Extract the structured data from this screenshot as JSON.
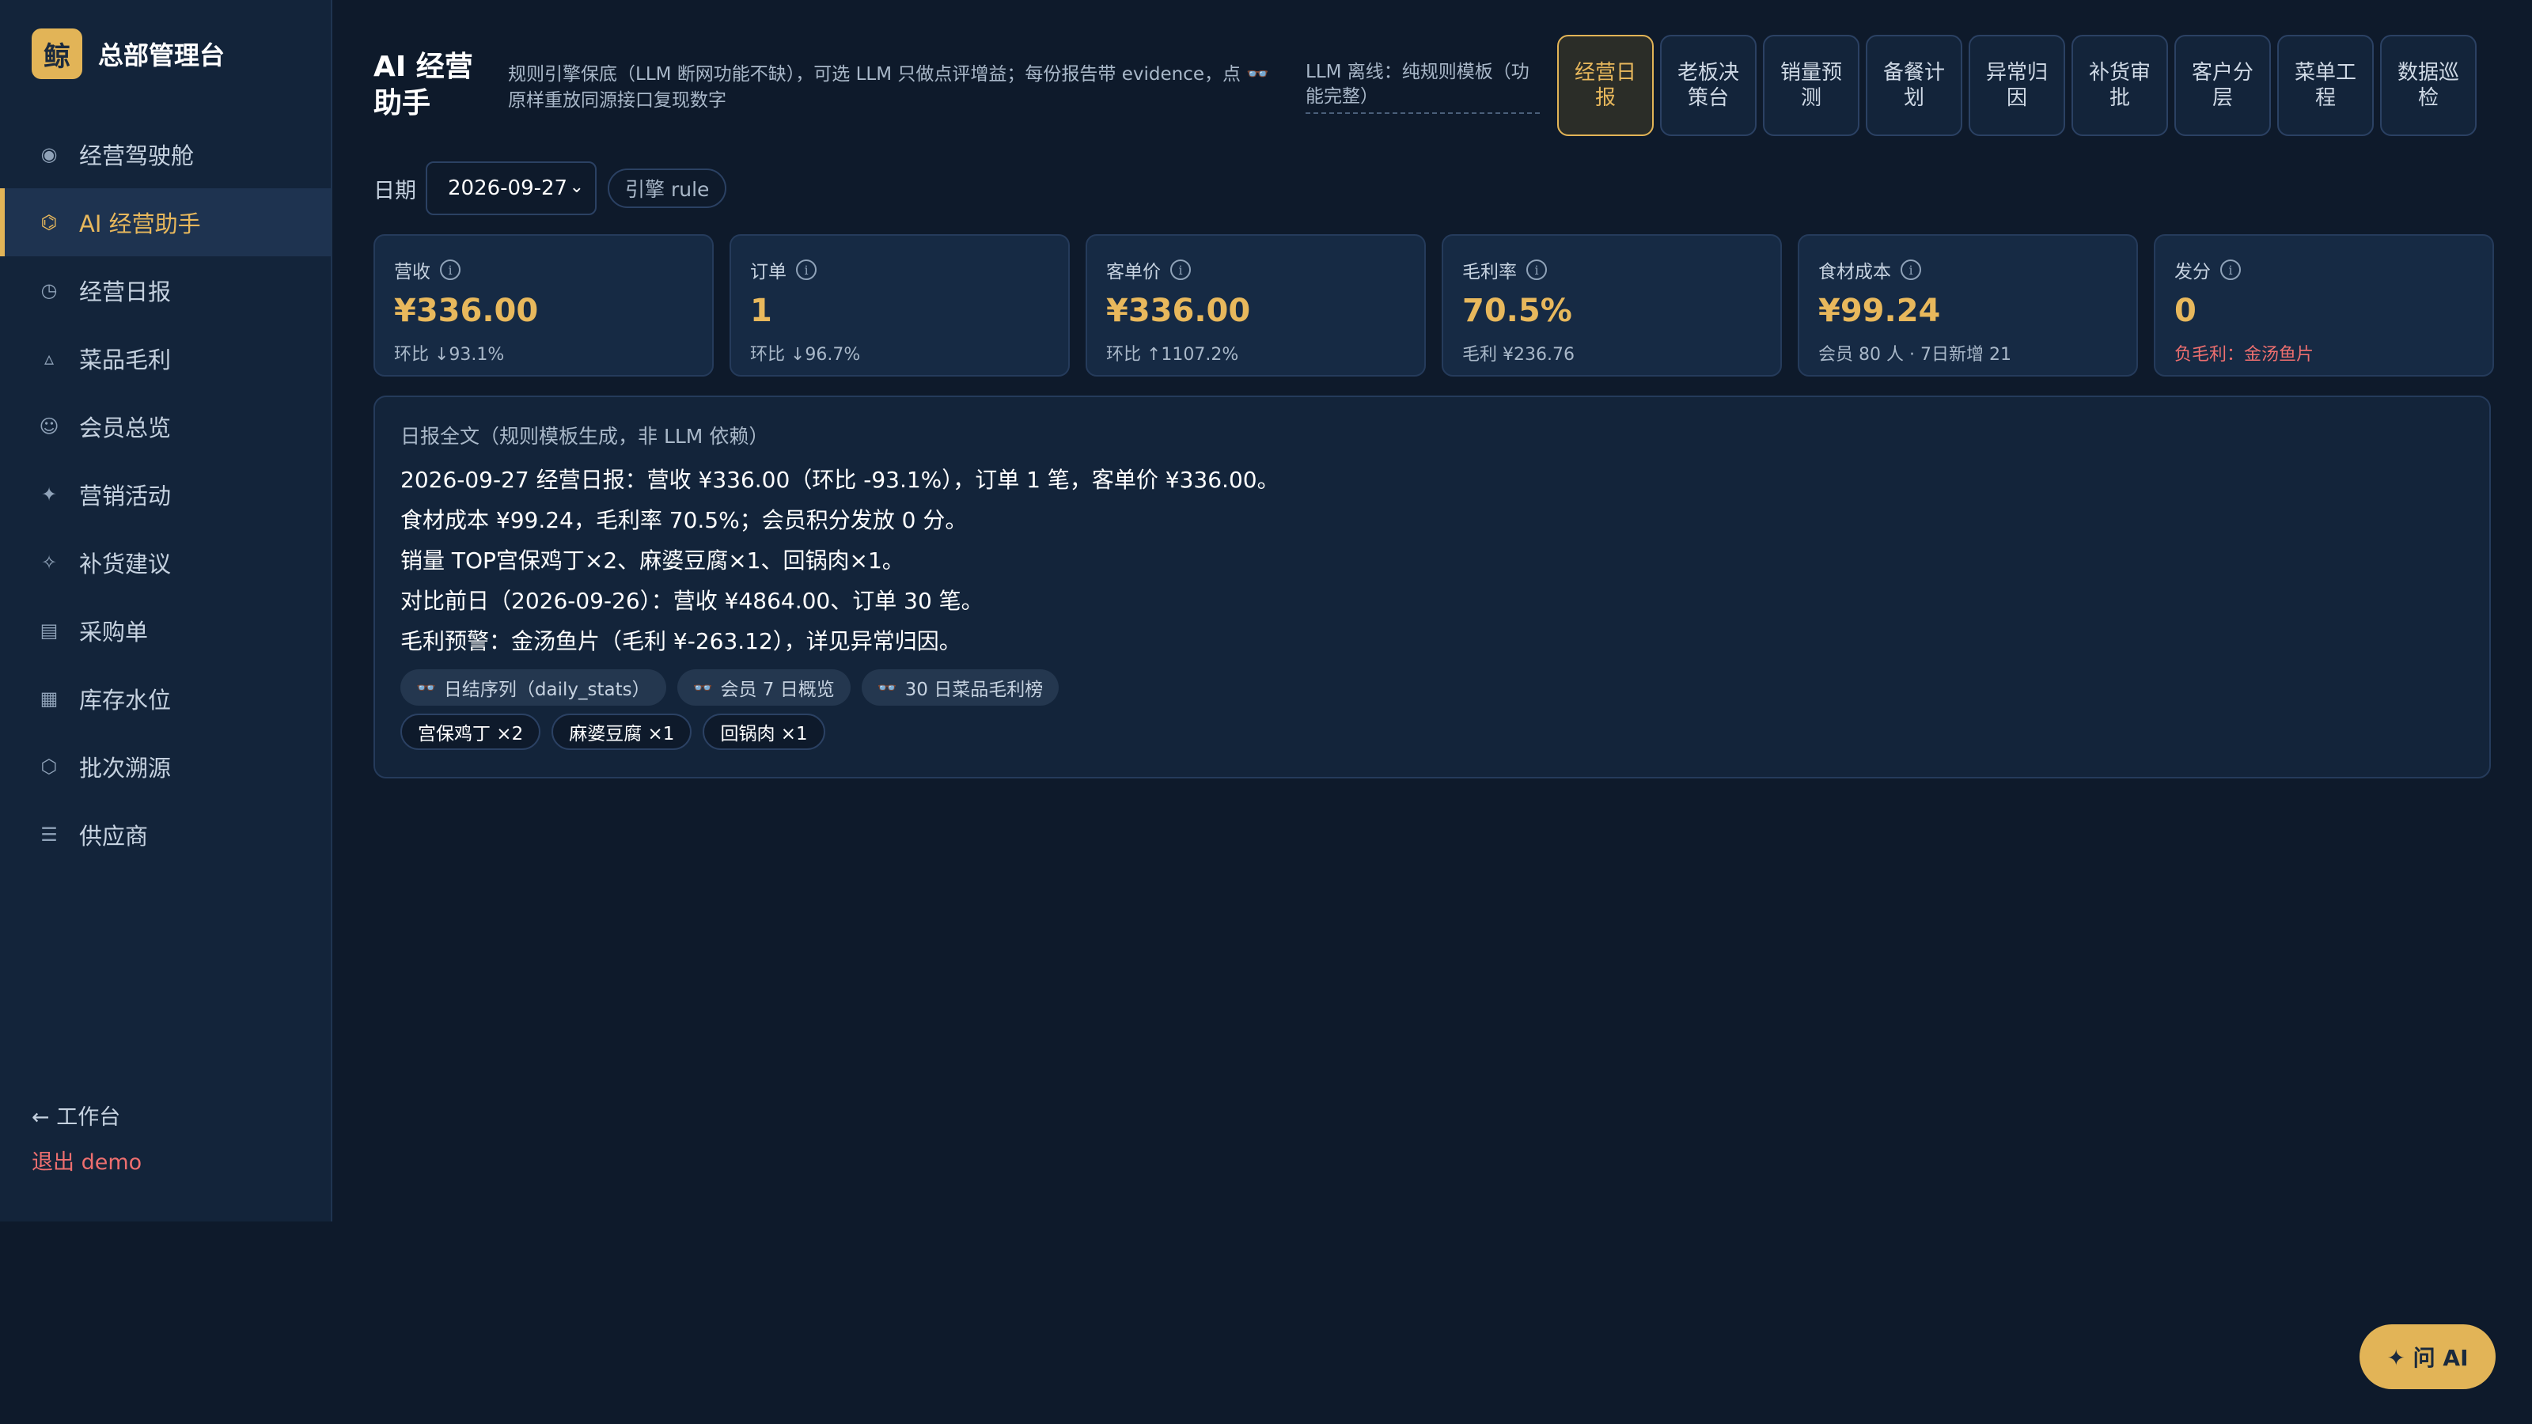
{
  "brand": {
    "logo_char": "鲸",
    "name": "总部管理台"
  },
  "sidebar": {
    "items": [
      {
        "icon": "◉",
        "label": "经营驾驶舱"
      },
      {
        "icon": "⌬",
        "label": "AI 经营助手"
      },
      {
        "icon": "◷",
        "label": "经营日报"
      },
      {
        "icon": "▵",
        "label": "菜品毛利"
      },
      {
        "icon": "☺",
        "label": "会员总览"
      },
      {
        "icon": "✦",
        "label": "营销活动"
      },
      {
        "icon": "✧",
        "label": "补货建议"
      },
      {
        "icon": "▤",
        "label": "采购单"
      },
      {
        "icon": "▦",
        "label": "库存水位"
      },
      {
        "icon": "⬡",
        "label": "批次溯源"
      },
      {
        "icon": "☰",
        "label": "供应商"
      }
    ],
    "active_index": 1,
    "back_label": "← 工作台",
    "logout_label": "退出 demo"
  },
  "header": {
    "title": "AI 经营助手",
    "description": "规则引擎保底（LLM 断网功能不缺），可选 LLM 只做点评增益；每份报告带 evidence，点 👓 原样重放同源接口复现数字",
    "llm_note": "LLM 离线：纯规则模板（功能完整）"
  },
  "tabs": [
    {
      "label": "经营日报",
      "active": true
    },
    {
      "label": "老板决策台",
      "active": false
    },
    {
      "label": "销量预测",
      "active": false
    },
    {
      "label": "备餐计划",
      "active": false
    },
    {
      "label": "异常归因",
      "active": false
    },
    {
      "label": "补货审批",
      "active": false
    },
    {
      "label": "客户分层",
      "active": false
    },
    {
      "label": "菜单工程",
      "active": false
    },
    {
      "label": "数据巡检",
      "active": false
    }
  ],
  "filters": {
    "date_label": "日期",
    "date_value": "2026-09-27",
    "engine_label": "引擎 rule"
  },
  "kpis": [
    {
      "label": "营收",
      "value": "¥336.00",
      "sub": "环比 ↓93.1%",
      "warn": false
    },
    {
      "label": "订单",
      "value": "1",
      "sub": "环比 ↓96.7%",
      "warn": false
    },
    {
      "label": "客单价",
      "value": "¥336.00",
      "sub": "环比 ↑1107.2%",
      "warn": false
    },
    {
      "label": "毛利率",
      "value": "70.5%",
      "sub": "毛利 ¥236.76",
      "warn": false
    },
    {
      "label": "食材成本",
      "value": "¥99.24",
      "sub": "会员 80 人 · 7日新增 21",
      "warn": false
    },
    {
      "label": "发分",
      "value": "0",
      "sub": "负毛利：金汤鱼片",
      "warn": true
    }
  ],
  "report": {
    "title": "日报全文（规则模板生成，非 LLM 依赖）",
    "lines": [
      "2026-09-27 经营日报：营收 ¥336.00（环比 -93.1%），订单 1 笔，客单价 ¥336.00。",
      "食材成本 ¥99.24，毛利率 70.5%；会员积分发放 0 分。",
      "销量 TOP宫保鸡丁×2、麻婆豆腐×1、回锅肉×1。",
      "对比前日（2026-09-26）：营收 ¥4864.00、订单 30 笔。",
      "毛利预警：金汤鱼片（毛利 ¥-263.12），详见异常归因。"
    ],
    "evidence": [
      {
        "icon": "👓",
        "label": "日结序列（daily_stats）"
      },
      {
        "icon": "👓",
        "label": "会员 7 日概览"
      },
      {
        "icon": "👓",
        "label": "30 日菜品毛利榜"
      }
    ],
    "dishes": [
      "宫保鸡丁 ×2",
      "麻婆豆腐 ×1",
      "回锅肉 ×1"
    ]
  },
  "ask_ai_label": "✦ 问 AI",
  "colors": {
    "accent": "#e2b457",
    "bg": "#0e1a2b",
    "warn": "#ee6f6f"
  }
}
